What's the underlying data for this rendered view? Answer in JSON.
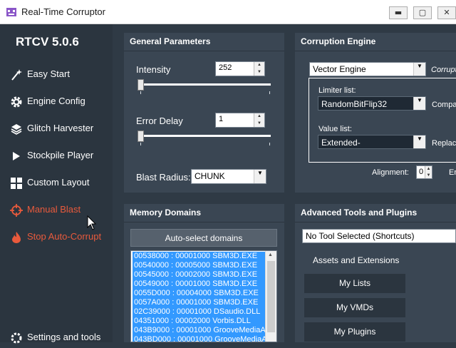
{
  "window": {
    "title": "Real-Time Corruptor",
    "minimize": "▬",
    "maximize": "▢",
    "close": "✕"
  },
  "sidebar": {
    "version": "RTCV 5.0.6",
    "items": [
      {
        "label": "Easy Start",
        "icon": "wand-icon"
      },
      {
        "label": "Engine Config",
        "icon": "gear-icon"
      },
      {
        "label": "Glitch Harvester",
        "icon": "layers-icon"
      },
      {
        "label": "Stockpile Player",
        "icon": "play-icon"
      },
      {
        "label": "Custom Layout",
        "icon": "grid-icon"
      },
      {
        "label": "Manual Blast",
        "icon": "crosshair-icon"
      },
      {
        "label": "Stop Auto-Corrupt",
        "icon": "flame-icon"
      },
      {
        "label": "Settings and tools",
        "icon": "settings-icon"
      }
    ]
  },
  "general": {
    "header": "General Parameters",
    "intensity_label": "Intensity",
    "intensity_value": "252",
    "error_delay_label": "Error Delay",
    "error_delay_value": "1",
    "blast_radius_label": "Blast Radius:",
    "blast_radius_value": "CHUNK"
  },
  "engine": {
    "header": "Corruption Engine",
    "engine_value": "Vector Engine",
    "corrupt_label": "Corrupt",
    "limiter_label": "Limiter list:",
    "limiter_value": "RandomBitFlip32",
    "compare_label": "Compa",
    "value_label": "Value list:",
    "value_value": "Extended-",
    "replace_label": "Replac",
    "alignment_label": "Alignment:",
    "alignment_value": "0",
    "trailing_label": "Er"
  },
  "memory": {
    "header": "Memory Domains",
    "autoselect_label": "Auto-select domains",
    "domains": [
      {
        "text": "00538000 : 00001000 SBM3D.EXE",
        "selected": true
      },
      {
        "text": "00540000 : 00005000 SBM3D.EXE",
        "selected": true
      },
      {
        "text": "00545000 : 00002000 SBM3D.EXE",
        "selected": true
      },
      {
        "text": "00549000 : 00001000 SBM3D.EXE",
        "selected": true
      },
      {
        "text": "0055D000 : 00004000 SBM3D.EXE",
        "selected": true
      },
      {
        "text": "0057A000 : 00001000 SBM3D.EXE",
        "selected": true
      },
      {
        "text": "02C39000 : 00001000 DSaudio.DLL",
        "selected": true
      },
      {
        "text": "04351000 : 00002000 Vorbis.DLL",
        "selected": true
      },
      {
        "text": "043B9000 : 00001000 GrooveMediaA",
        "selected": true
      },
      {
        "text": "043BD000 : 00001000 GrooveMediaA",
        "selected": true
      }
    ]
  },
  "advanced": {
    "header": "Advanced Tools and Plugins",
    "tool_select_value": "No Tool Selected (Shortcuts)",
    "assets_label": "Assets and Extensions",
    "buttons": [
      "My Lists",
      "My VMDs",
      "My Plugins"
    ]
  },
  "colors": {
    "sidebar_bg": "#2b353f",
    "panel_bg": "#3a4653",
    "accent_red": "#e95a3c",
    "selection_blue": "#3399ff"
  }
}
